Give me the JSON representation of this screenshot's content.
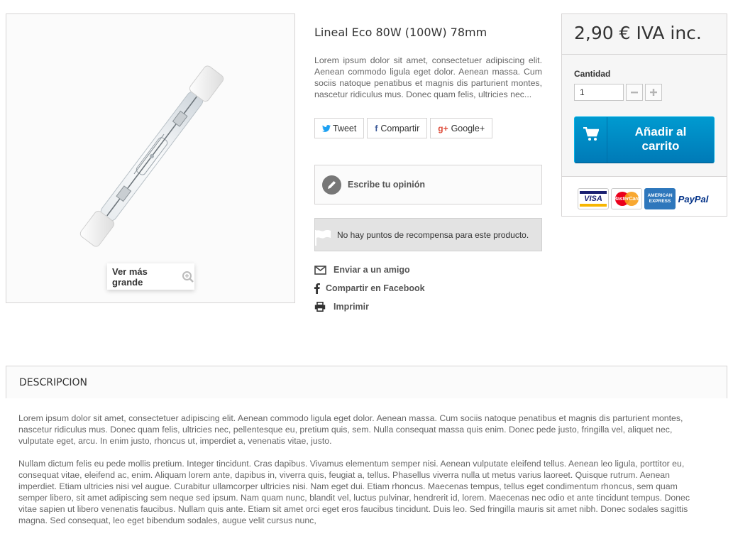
{
  "product": {
    "title": "Lineal Eco 80W (100W) 78mm",
    "short_description": "Lorem ipsum dolor sit amet, consectetuer adipiscing elit. Aenean commodo ligula eget dolor. Aenean massa. Cum sociis natoque penatibus et magnis dis parturient montes, nascetur ridiculus mus. Donec quam felis, ultricies nec...",
    "zoom_label": "Ver más grande"
  },
  "social": {
    "tweet": "Tweet",
    "facebook": "Compartir",
    "google": "Google+"
  },
  "review": {
    "label": "Escribe tu opinión"
  },
  "loyalty": {
    "message": "No hay puntos de recompensa para este producto."
  },
  "links": {
    "send_friend": "Enviar a un amigo",
    "share_facebook": "Compartir en Facebook",
    "print": "Imprimir"
  },
  "buy": {
    "price": "2,90 € IVA inc.",
    "quantity_label": "Cantidad",
    "quantity_value": "1",
    "add_to_cart_line1": "Añadir al",
    "add_to_cart_line2": "carrito",
    "payment_methods": [
      "VISA",
      "MasterCard",
      "AMERICAN EXPRESS",
      "PayPal"
    ],
    "colors": {
      "button": "#0088c8",
      "visa": "#1a1f71",
      "mastercard_red": "#eb001b",
      "mastercard_orange": "#f79e1b",
      "amex": "#2e77bc",
      "paypal": "#003087"
    }
  },
  "description": {
    "heading": "DESCRIPCION",
    "paragraph1": "Lorem ipsum dolor sit amet, consectetuer adipiscing elit. Aenean commodo ligula eget dolor. Aenean massa. Cum sociis natoque penatibus et magnis dis parturient montes, nascetur ridiculus mus. Donec quam felis, ultricies nec, pellentesque eu, pretium quis, sem. Nulla consequat massa quis enim. Donec pede justo, fringilla vel, aliquet nec, vulputate eget, arcu. In enim justo, rhoncus ut, imperdiet a, venenatis vitae, justo.",
    "paragraph2": "Nullam dictum felis eu pede mollis pretium. Integer tincidunt. Cras dapibus. Vivamus elementum semper nisi. Aenean vulputate eleifend tellus. Aenean leo ligula, porttitor eu, consequat vitae, eleifend ac, enim. Aliquam lorem ante, dapibus in, viverra quis, feugiat a, tellus. Phasellus viverra nulla ut metus varius laoreet. Quisque rutrum. Aenean imperdiet. Etiam ultricies nisi vel augue. Curabitur ullamcorper ultricies nisi. Nam eget dui. Etiam rhoncus. Maecenas tempus, tellus eget condimentum rhoncus, sem quam semper libero, sit amet adipiscing sem neque sed ipsum. Nam quam nunc, blandit vel, luctus pulvinar, hendrerit id, lorem. Maecenas nec odio et ante tincidunt tempus. Donec vitae sapien ut libero venenatis faucibus. Nullam quis ante. Etiam sit amet orci eget eros faucibus tincidunt. Duis leo. Sed fringilla mauris sit amet nibh. Donec sodales sagittis magna. Sed consequat, leo eget bibendum sodales, augue velit cursus nunc,"
  }
}
